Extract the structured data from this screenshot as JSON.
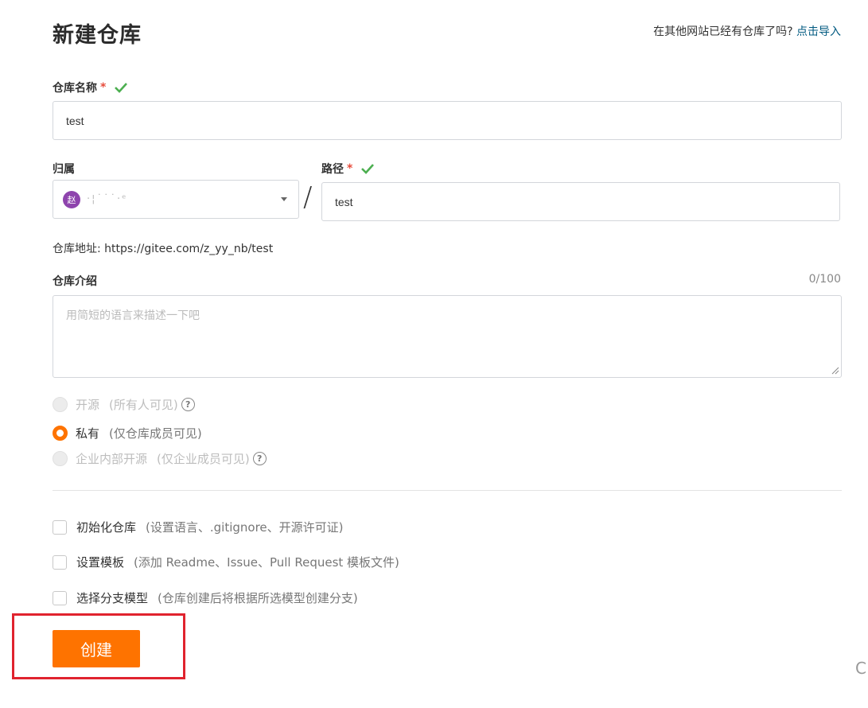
{
  "header": {
    "title": "新建仓库",
    "import_prompt": "在其他网站已经有仓库了吗?",
    "import_link": "点击导入"
  },
  "repo_name": {
    "label": "仓库名称",
    "required_mark": "*",
    "value": "test"
  },
  "owner": {
    "label": "归属",
    "avatar_text": "赵",
    "name": "·¦˙˙˙·ᵉ"
  },
  "path": {
    "label": "路径",
    "required_mark": "*",
    "separator": "/",
    "value": "test"
  },
  "repo_url": {
    "text": "仓库地址: https://gitee.com/z_yy_nb/test"
  },
  "description": {
    "label": "仓库介绍",
    "counter": "0/100",
    "placeholder": "用简短的语言来描述一下吧"
  },
  "visibility": {
    "options": [
      {
        "label": "开源",
        "note": "(所有人可见)",
        "disabled": true,
        "checked": false
      },
      {
        "label": "私有",
        "note": "(仅仓库成员可见)",
        "disabled": false,
        "checked": true
      },
      {
        "label": "企业内部开源",
        "note": "(仅企业成员可见)",
        "disabled": true,
        "checked": false
      }
    ],
    "help_glyph": "?"
  },
  "options": {
    "init_repo": {
      "label": "初始化仓库",
      "note": "(设置语言、.gitignore、开源许可证)"
    },
    "template": {
      "label": "设置模板",
      "note": "(添加 Readme、Issue、Pull Request 模板文件)"
    },
    "branch_model": {
      "label": "选择分支模型",
      "note": "(仓库创建后将根据所选模型创建分支)"
    }
  },
  "actions": {
    "create": "创建"
  },
  "edge": {
    "glyph": "C"
  },
  "colors": {
    "accent": "#fe7300",
    "link": "#005980",
    "success": "#4caf50",
    "required": "#e74c3c",
    "highlight": "#e0232e"
  }
}
